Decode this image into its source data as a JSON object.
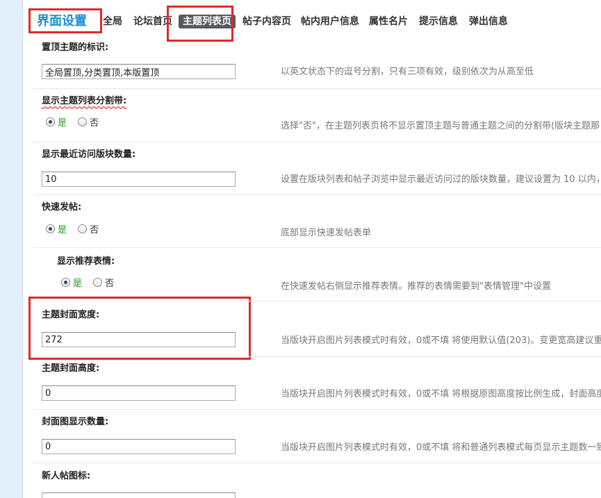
{
  "nav": {
    "title": "界面设置",
    "tabs": [
      "全局",
      "论坛首页",
      "主题列表页",
      "帖子内容页",
      "帖内用户信息",
      "属性名片",
      "提示信息",
      "弹出信息"
    ],
    "active_tab": "主题列表页"
  },
  "radio_labels": {
    "yes": "是",
    "no": "否"
  },
  "settings": {
    "sticky_ident": {
      "label": "置顶主题的标识:",
      "value": "全局置顶,分类置顶,本版置顶",
      "hint": "以英文状态下的逗号分割，只有三项有效，级别依次为从高至低"
    },
    "separator": {
      "label": "显示主题列表分割带:",
      "selected": "yes",
      "hint": "选择\"否\"，在主题列表页将不显示置顶主题与普通主题之间的分割带(版块主题那"
    },
    "recent_forums": {
      "label": "显示最近访问版块数量:",
      "value": "10",
      "hint": "设置在版块列表和帖子浏览中显示最近访问过的版块数量，建议设置为 10 以内，"
    },
    "quick_post": {
      "label": "快速发帖:",
      "selected": "yes",
      "hint": "底部显示快速发帖表单"
    },
    "recommend_smilies": {
      "label": "显示推荐表情:",
      "selected": "yes",
      "hint": "在快速发帖右侧显示推荐表情。推荐的表情需要到\"表情管理\"中设置"
    },
    "cover_width": {
      "label": "主题封面宽度:",
      "value": "272",
      "hint": "当版块开启图片列表模式时有效，0或不填 将使用默认值(203)。变更宽高建议重"
    },
    "cover_height": {
      "label": "主题封面高度:",
      "value": "0",
      "hint": "当版块开启图片列表模式时有效，0或不填 将根据原图高度按比例生成，封面高度"
    },
    "cover_count": {
      "label": "封面图显示数量:",
      "value": "0",
      "hint": "当版块开启图片列表模式时有效，0或不填 将和普通列表模式每页显示主题数一致"
    },
    "new_post_icon": {
      "label": "新人帖图标:"
    }
  }
}
